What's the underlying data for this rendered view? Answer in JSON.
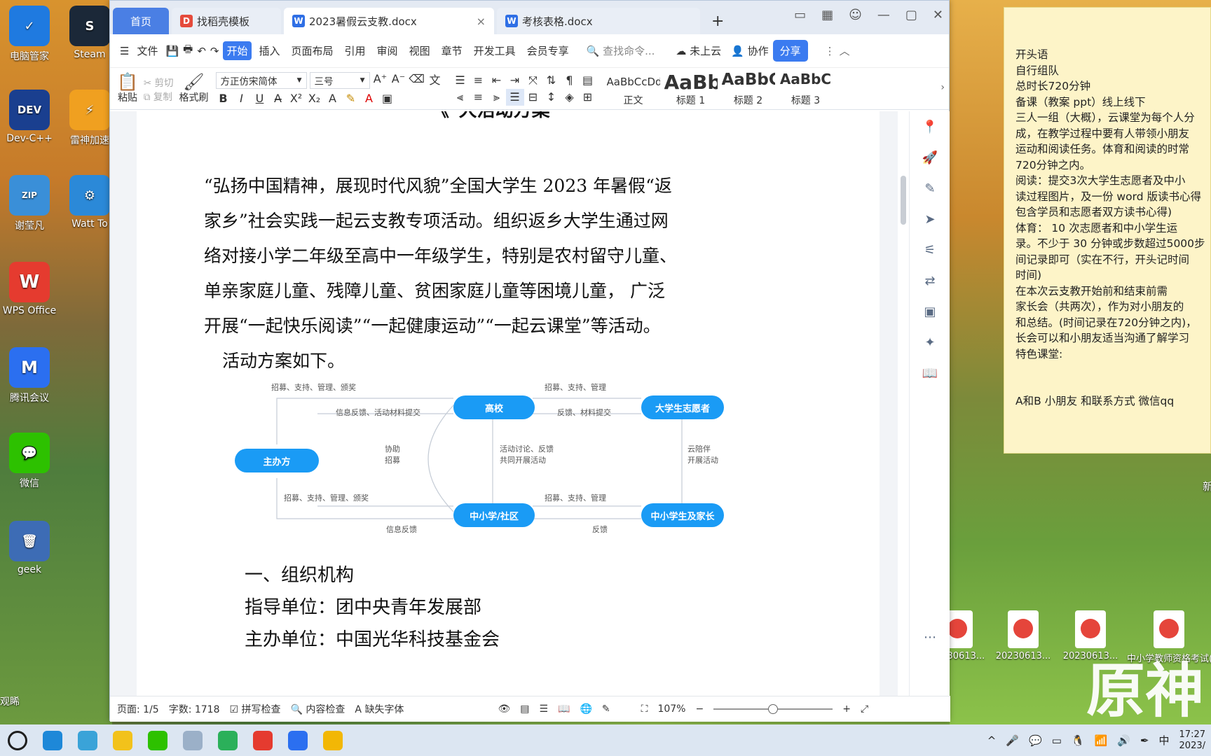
{
  "desktop": {
    "icons_left": [
      {
        "label": "电脑管家",
        "color": "#1f7ae0",
        "glyph": "✓"
      },
      {
        "label": "Dev-C++",
        "color": "#1a3f8f",
        "glyph": "DEV"
      },
      {
        "label": "谢莹凡",
        "color": "#3a8fd8",
        "glyph": "ZIP"
      },
      {
        "label": "WPS Office",
        "color": "#e53b2f",
        "glyph": "W"
      },
      {
        "label": "腾讯会议",
        "color": "#2b6ff0",
        "glyph": "M"
      },
      {
        "label": "微信",
        "color": "#2dc100",
        "glyph": "💬"
      },
      {
        "label": "geek",
        "color": "#3d6cb5",
        "glyph": "🗑"
      }
    ],
    "icons_col2": [
      {
        "label": "Steam",
        "color": "#1b2838",
        "glyph": "S"
      },
      {
        "label": "雷神加速",
        "color": "#f0a020",
        "glyph": "⚡"
      },
      {
        "label": "Watt To",
        "color": "#2b89d8",
        "glyph": "⚙"
      }
    ],
    "bottom_left_text": "观睎",
    "right_files": [
      {
        "label": "20230613..."
      },
      {
        "label": "20230613..."
      },
      {
        "label": "20230613..."
      },
      {
        "label": "中小学教师资格考试(NI..."
      }
    ],
    "right_edge_text": "新",
    "watermark": "原神"
  },
  "sticky_note": {
    "lines": [
      "开头语",
      "自行组队",
      "总时长720分钟",
      "备课（教案 ppt）线上线下",
      "三人一组（大概），云课堂为每个人分",
      "成，在教学过程中要有人带领小朋友",
      "运动和阅读任务。体育和阅读的时常",
      "720分钟之内。",
      "    阅读：提交3次大学生志愿者及中小",
      "读过程图片，及一份 word 版读书心得",
      "包含学员和志愿者双方读书心得)",
      "    体育： 10 次志愿者和中小学生运",
      "录。不少于 30 分钟或步数超过5000步",
      "间记录即可（实在不行，开头记时间",
      "时间)",
      "      在本次云支教开始前和结束前需",
      "家长会（共两次），作为对小朋友的",
      "和总结。(时间记录在720分钟之内)，",
      "长会可以和小朋友适当沟通了解学习",
      "      特色课堂:",
      "",
      "",
      "A和B   小朋友 和联系方式   微信qq"
    ]
  },
  "window": {
    "tabs": [
      {
        "label": "首页",
        "type": "home"
      },
      {
        "label": "找稻壳模板",
        "icon_color": "#e54b3c",
        "icon": "D"
      },
      {
        "label": "2023暑假云支教.docx",
        "icon_color": "#2f6fe5",
        "icon": "W",
        "active": true
      },
      {
        "label": "考核表格.docx",
        "icon_color": "#2f6fe5",
        "icon": "W"
      }
    ],
    "new_tab": "+",
    "menu": {
      "file": "文件",
      "items": [
        "开始",
        "插入",
        "页面布局",
        "引用",
        "审阅",
        "视图",
        "章节",
        "开发工具",
        "会员专享"
      ],
      "active": "开始",
      "search_placeholder": "查找命令...",
      "cloud": "未上云",
      "collab": "协作",
      "share": "分享"
    },
    "ribbon": {
      "paste": "粘贴",
      "cut": "剪切",
      "copy": "复制",
      "format_painter": "格式刷",
      "font": "方正仿宋简体",
      "size": "三号",
      "styles": [
        {
          "preview": "AaBbCcDd",
          "label": "正文"
        },
        {
          "preview": "AaBb",
          "label": "标题 1"
        },
        {
          "preview": "AaBbC",
          "label": "标题 2"
        },
        {
          "preview": "AaBbC",
          "label": "标题 3"
        }
      ]
    },
    "document": {
      "top_cut_title": "《*大活动方案",
      "paragraph": "“弘扬中国精神，展现时代风貌”全国大学生 2023 年暑假“返家乡”社会实践一起云支教专项活动。组织返乡大学生通过网络对接小学二年级至高中一年级学生，特别是农村留守儿童、单亲家庭儿童、残障儿童、贫困家庭儿童等困境儿童， 广泛开展“一起快乐阅读”“一起健康运动”“一起云课堂”等活动。",
      "para2": "活动方案如下。",
      "heading1": "一、组织机构",
      "line1": "指导单位：团中央青年发展部",
      "line2_cut": "主办单位：中国光华科技基金会",
      "flowchart": {
        "nodes": [
          "主办方",
          "高校",
          "大学生志愿者",
          "中小学/社区",
          "中小学生及家长"
        ],
        "labels": [
          "招募、支持、管理、颁奖",
          "信息反馈、活动材料提交",
          "招募、支持、管理",
          "反馈、材料提交",
          "协助",
          "招募",
          "活动讨论、反馈",
          "共同开展活动",
          "云陪伴",
          "开展活动",
          "招募、支持、管理、颁奖",
          "招募、支持、管理",
          "信息反馈",
          "反馈"
        ]
      }
    },
    "status": {
      "page": "页面: 1/5",
      "words": "字数: 1718",
      "spell": "拼写检查",
      "content_check": "内容检查",
      "missing_font": "缺失字体",
      "zoom": "107%"
    }
  },
  "taskbar": {
    "apps": [
      {
        "name": "search",
        "color": "#1f1f1f"
      },
      {
        "name": "edge",
        "color": "#1e88d8"
      },
      {
        "name": "photos",
        "color": "#3aa3d8"
      },
      {
        "name": "sticky-notes",
        "color": "#f2c21b"
      },
      {
        "name": "wechat",
        "color": "#2dc100"
      },
      {
        "name": "globe",
        "color": "#9bb0c8"
      },
      {
        "name": "remote",
        "color": "#2bb05a"
      },
      {
        "name": "wps",
        "color": "#e53b2f"
      },
      {
        "name": "tencent-meeting",
        "color": "#2b6ff0"
      },
      {
        "name": "explorer",
        "color": "#f2b705"
      }
    ],
    "ime": "中",
    "time": "17:27",
    "date": "2023/"
  }
}
